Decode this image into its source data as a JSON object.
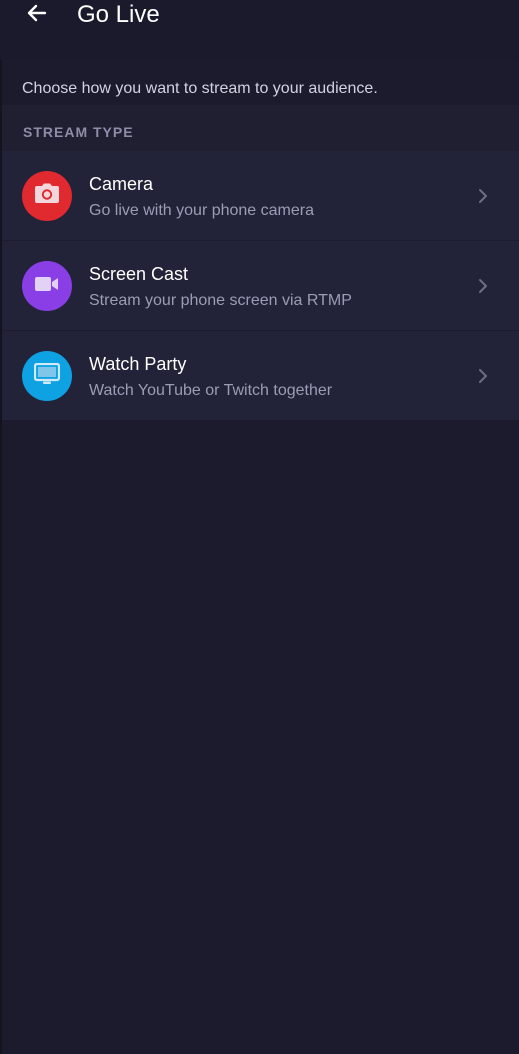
{
  "header": {
    "title": "Go Live",
    "back_icon": "arrow-left-icon"
  },
  "intro": "Choose how you want to stream to your audience.",
  "section": {
    "label": "STREAM TYPE"
  },
  "stream_types": [
    {
      "title": "Camera",
      "subtitle": "Go live with your phone camera",
      "icon": "camera-icon",
      "color": "#e02a2f"
    },
    {
      "title": "Screen Cast",
      "subtitle": "Stream your phone screen via RTMP",
      "icon": "video-camera-icon",
      "color": "#8a3ee6"
    },
    {
      "title": "Watch Party",
      "subtitle": "Watch YouTube or Twitch together",
      "icon": "monitor-icon",
      "color": "#0ea2e3"
    }
  ],
  "colors": {
    "background": "#1b1b2d",
    "row": "#222238",
    "icon_glyph": "#ffffff"
  }
}
